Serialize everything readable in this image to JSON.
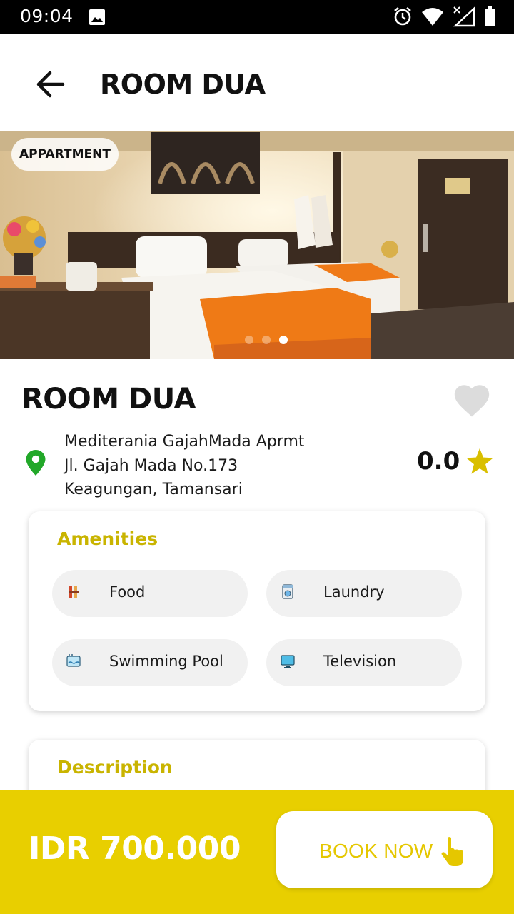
{
  "status_bar": {
    "time": "09:04"
  },
  "app_bar": {
    "title": "ROOM DUA"
  },
  "hero": {
    "badge": "APPARTMENT",
    "slides_total": 3,
    "active_slide": 3
  },
  "room": {
    "name": "ROOM DUA",
    "favorite": false,
    "address_lines": [
      "Mediterania GajahMada Aprmt",
      "Jl. Gajah Mada No.173",
      "Keagungan, Tamansari"
    ],
    "rating": "0.0"
  },
  "amenities": {
    "title": "Amenities",
    "items": [
      {
        "label": "Food",
        "icon": "food-icon"
      },
      {
        "label": "Laundry",
        "icon": "laundry-icon"
      },
      {
        "label": "Swimming Pool",
        "icon": "swimming-pool-icon"
      },
      {
        "label": "Television",
        "icon": "television-icon"
      }
    ]
  },
  "description": {
    "title": "Description"
  },
  "booking": {
    "price": "IDR 700.000",
    "button_label": "BOOK NOW"
  },
  "colors": {
    "accent": "#e8cf00",
    "heading_gold": "#c9b400",
    "pin_green": "#22a829",
    "star": "#d9bf00"
  }
}
